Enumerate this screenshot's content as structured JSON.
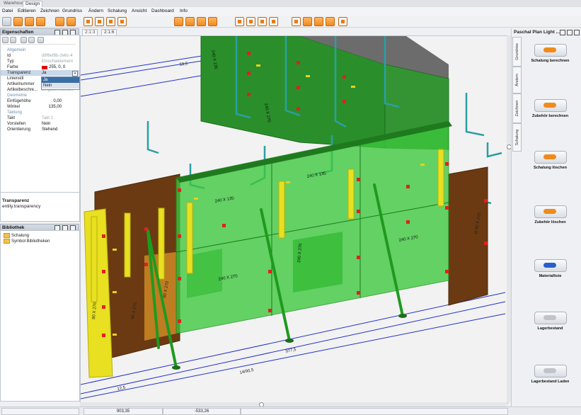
{
  "top_tabs": [
    "Warehouse",
    "Design"
  ],
  "menu": [
    "Datei",
    "Editieren",
    "Zeichnen",
    "Grundriss",
    "Ändern",
    "Schalung",
    "Ansicht",
    "Dashboard",
    "Info"
  ],
  "properties": {
    "title": "Eigenschaften",
    "sections": {
      "allgemein": "Allgemein",
      "geometrie": "Geometrie",
      "taktung": "Taktung"
    },
    "rows": [
      {
        "key": "Id",
        "value": "d8f6ef8b-2e6c-4"
      },
      {
        "key": "Typ",
        "value": "Einschalelement"
      },
      {
        "key": "Farbe",
        "value": "255, 0, 0"
      },
      {
        "key": "Transparenz",
        "value": "Ja"
      },
      {
        "key": "Linienstil",
        "value": ""
      },
      {
        "key": "Artikelnummer",
        "value": ""
      },
      {
        "key": "Artikelbeschre...",
        "value": "Eingabefeldfeld..."
      },
      {
        "key": "Einfügehöhe",
        "value": "0,00"
      },
      {
        "key": "Winkel",
        "value": "135,00"
      },
      {
        "key": "Takt",
        "value": "Takt 1"
      },
      {
        "key": "Vorstellen",
        "value": "Nein"
      },
      {
        "key": "Orientierung",
        "value": "Stehend"
      }
    ],
    "dropdown_options": [
      "Ja",
      "Nein"
    ],
    "color_swatch": "#e3000f"
  },
  "description": {
    "title": "Transparenz",
    "text": "entity.transparency"
  },
  "library": {
    "title": "Bibliothek",
    "items": [
      "Schalung",
      "Symbol Bibliotheken"
    ]
  },
  "view_tabs": [
    "2:1:3",
    "2:1:6"
  ],
  "dimensions": [
    "59,5",
    "977,5",
    "14/90,5",
    "12,5"
  ],
  "panel_labels": [
    "240 X 135",
    "240 X 135",
    "240 X 270",
    "240 X 270",
    "240 X 270",
    "240 X 270",
    "90 X 270",
    "90 X 270",
    "90 X 270",
    "M 90 X 270",
    "240 X 135"
  ],
  "right_panel": {
    "title": "Paschal Plan Light ...",
    "vertical_tabs": [
      "Grundriss",
      "Ändern",
      "Zeichnen",
      "Schalung"
    ],
    "actions": [
      {
        "label": "Schalung berechnen",
        "icon": "orange"
      },
      {
        "label": "Zubehör berechnen",
        "icon": "orange"
      },
      {
        "label": "Schalung löschen",
        "icon": "orange"
      },
      {
        "label": "Zubehör löschen",
        "icon": "orange"
      },
      {
        "label": "Materialliste",
        "icon": "blue"
      },
      {
        "label": "Lagerbestand",
        "icon": "grey"
      },
      {
        "label": "Lagerbestand Laden",
        "icon": "grey"
      }
    ]
  },
  "status": {
    "x": "903,35",
    "y": "-533,26"
  },
  "colors": {
    "accent": "#f08a1c",
    "green_panel": "#3cc83c",
    "brown_panel": "#6b3a12",
    "yellow_waler": "#e8e020"
  }
}
